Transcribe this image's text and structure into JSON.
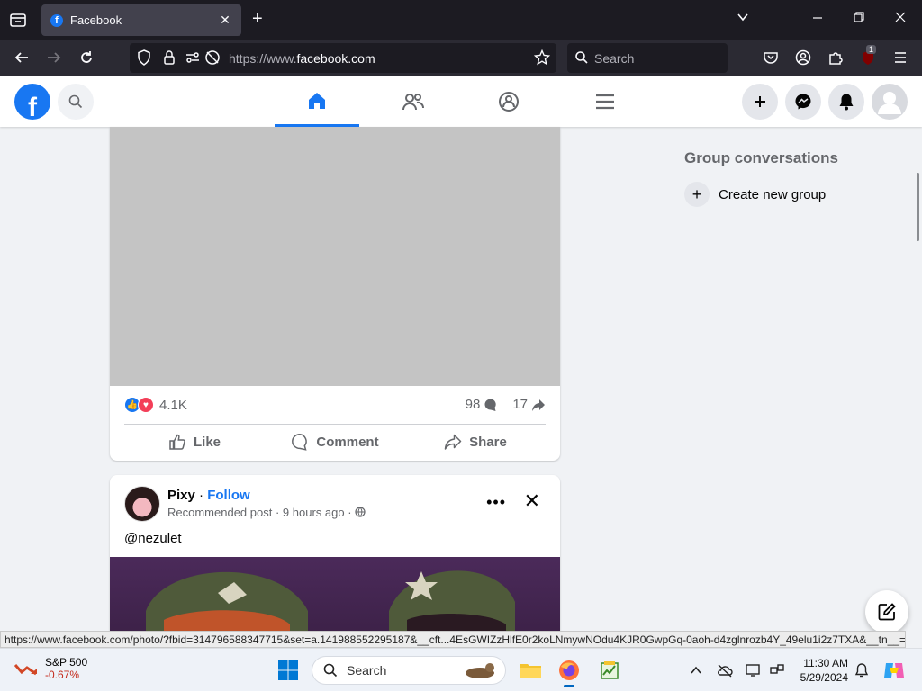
{
  "browser": {
    "tab_title": "Facebook",
    "url_prefix": "https://www.",
    "url_domain": "facebook.com",
    "url_suffix": "",
    "search_placeholder": "Search",
    "extension_badge": "1"
  },
  "right_column": {
    "group_heading": "Group conversations",
    "create_group": "Create new group"
  },
  "post1": {
    "reaction_count": "4.1K",
    "comment_count": "98",
    "share_count": "17",
    "like_label": "Like",
    "comment_label": "Comment",
    "share_label": "Share"
  },
  "post2": {
    "author": "Pixy",
    "separator": " · ",
    "follow_label": "Follow",
    "meta_type": "Recommended post",
    "meta_time": "9 hours ago",
    "caption": "@nezulet"
  },
  "status_url": "https://www.facebook.com/photo/?fbid=314796588347715&set=a.141988552295187&__cft...4EsGWIZzHlfE0r2koLNmywNOdu4KJR0GwpGq-0aoh-d4zglnrozb4Y_49elu1i2z7TXA&__tn__=EH-R",
  "taskbar": {
    "stock_name": "S&P 500",
    "stock_change": "-0.67%",
    "search_label": "Search",
    "time": "11:30 AM",
    "date": "5/29/2024"
  },
  "colors": {
    "facebook_blue": "#1877f2",
    "love_red": "#f33e58",
    "stock_red": "#c42b1c"
  }
}
